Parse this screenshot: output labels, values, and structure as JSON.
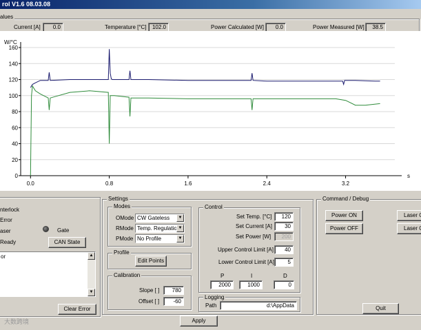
{
  "window": {
    "title": "rol V1.6 08.03.08"
  },
  "values_bar": {
    "group_label": "alues",
    "current_label": "Current [A]",
    "current_value": "0.0",
    "temperature_label": "Temperature [°C]",
    "temperature_value": "102.0",
    "power_calc_label": "Power Calculated [W]",
    "power_calc_value": "0.0",
    "power_meas_label": "Power Measured [W]",
    "power_meas_value": "38.5"
  },
  "chart_data": {
    "type": "line",
    "ylabel": "W/°C",
    "xlabel": "s",
    "xlim": [
      -0.1,
      3.7
    ],
    "ylim": [
      0,
      160
    ],
    "x_ticks": [
      "0.0",
      "0.8",
      "1.6",
      "2.4",
      "3.2"
    ],
    "y_ticks": [
      "0",
      "20",
      "40",
      "60",
      "80",
      "100",
      "120",
      "140",
      "160"
    ],
    "series": [
      {
        "color": "#1a1a6e",
        "x": [
          0.0,
          0.02,
          0.05,
          0.1,
          0.18,
          0.19,
          0.2,
          0.4,
          0.6,
          0.79,
          0.8,
          0.81,
          0.82,
          0.83,
          1.0,
          1.01,
          1.02,
          1.2,
          1.6,
          2.0,
          2.24,
          2.25,
          2.26,
          2.4,
          2.8,
          3.17,
          3.18,
          3.19,
          3.3,
          3.5,
          3.55
        ],
        "y": [
          110,
          114,
          116,
          119,
          119,
          129,
          119,
          120,
          120,
          120,
          158,
          128,
          121,
          120,
          120,
          131,
          120,
          120,
          119,
          119,
          119,
          128,
          119,
          118,
          118,
          118,
          114,
          119,
          119,
          118,
          118
        ]
      },
      {
        "color": "#2e8b3a",
        "x": [
          0.0,
          0.01,
          0.02,
          0.05,
          0.1,
          0.18,
          0.19,
          0.2,
          0.4,
          0.6,
          0.79,
          0.8,
          0.81,
          0.85,
          1.0,
          1.01,
          1.02,
          1.2,
          1.6,
          2.0,
          2.24,
          2.25,
          2.26,
          2.4,
          2.8,
          3.1,
          3.2,
          3.3,
          3.4,
          3.55
        ],
        "y": [
          0,
          100,
          112,
          106,
          102,
          97,
          82,
          97,
          104,
          106,
          104,
          40,
          100,
          100,
          98,
          74,
          97,
          97,
          96,
          96,
          96,
          82,
          96,
          96,
          96,
          96,
          94,
          88,
          88,
          90
        ]
      }
    ]
  },
  "status": {
    "interlock": "nterlock",
    "error": "Error",
    "laser": "aser",
    "gate": "Gate",
    "ready": "Ready",
    "can_state_button": "CAN State",
    "log_text": "or",
    "clear_error_button": "Clear Error"
  },
  "settings": {
    "group_label": "Settings",
    "modes": {
      "label": "Modes",
      "omode_label": "OMode",
      "omode_value": "CW Gateless",
      "rmode_label": "RMode",
      "rmode_value": "Temp. Regulation",
      "pmode_label": "PMode",
      "pmode_value": "No Profile"
    },
    "profile": {
      "label": "Profile",
      "edit_points_button": "Edit Points"
    },
    "calibration": {
      "label": "Calibration",
      "slope_label": "Slope [ ]",
      "slope_value": "780",
      "offset_label": "Offset [ ]",
      "offset_value": "-60"
    },
    "control": {
      "label": "Control",
      "set_temp_label": "Set Temp. [°C]",
      "set_temp_value": "120",
      "set_current_label": "Set Current [A]",
      "set_current_value": "30",
      "set_power_label": "Set Power [W]",
      "set_power_value": "200",
      "ucl_label": "Upper Control Limit [A]",
      "ucl_value": "40",
      "lcl_label": "Lower Control Limit [A]",
      "lcl_value": "5",
      "p_label": "P",
      "p_value": "2000",
      "i_label": "I",
      "i_value": "1000",
      "d_label": "D",
      "d_value": "0"
    },
    "logging": {
      "label": "Logging",
      "path_label": "Path",
      "path_value": "d:\\AppData"
    },
    "apply_button": "Apply"
  },
  "command": {
    "group_label": "Command / Debug",
    "power_on_button": "Power ON",
    "power_off_button": "Power OFF",
    "laser_on_button": "Laser O",
    "laser_off_button": "Laser O",
    "quit_button": "Quit"
  },
  "watermark": "大数跨境"
}
